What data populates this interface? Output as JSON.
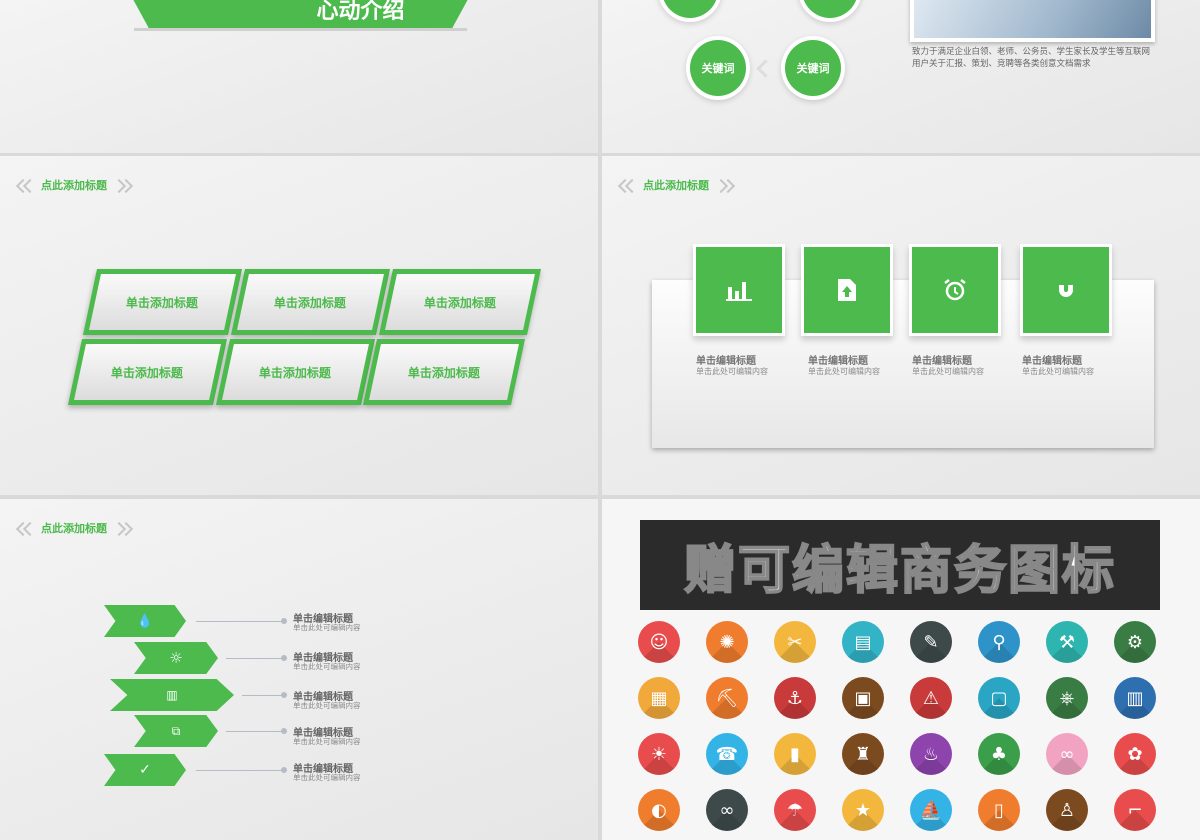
{
  "slide1": {
    "title_text": "心动介绍"
  },
  "slide2": {
    "keywords": [
      "关键词",
      "关键词"
    ],
    "description": "致力于满足企业白领、老师、公务员、学生家长及学生等互联网用户关于汇报、策划、竞聘等各类创意文档需求"
  },
  "slide3": {
    "header": "点此添加标题",
    "cards": [
      "单击添加标题",
      "单击添加标题",
      "单击添加标题",
      "单击添加标题",
      "单击添加标题",
      "单击添加标题"
    ]
  },
  "slide4": {
    "header": "点此添加标题",
    "items": [
      {
        "title": "单击编辑标题",
        "sub": "单击此处可编辑内容",
        "icon": "bar-chart-icon"
      },
      {
        "title": "单击编辑标题",
        "sub": "单击此处可编辑内容",
        "icon": "upload-icon"
      },
      {
        "title": "单击编辑标题",
        "sub": "单击此处可编辑内容",
        "icon": "alarm-clock-icon"
      },
      {
        "title": "单击编辑标题",
        "sub": "单击此处可编辑内容",
        "icon": "magnet-icon"
      }
    ]
  },
  "slide5": {
    "header": "点此添加标题",
    "items": [
      {
        "title": "单击编辑标题",
        "sub": "单击此处可编辑内容",
        "icon": "drops-icon"
      },
      {
        "title": "单击编辑标题",
        "sub": "单击此处可编辑内容",
        "icon": "sun-icon"
      },
      {
        "title": "单击编辑标题",
        "sub": "单击此处可编辑内容",
        "icon": "book-icon"
      },
      {
        "title": "单击编辑标题",
        "sub": "单击此处可编辑内容",
        "icon": "tags-icon"
      },
      {
        "title": "单击编辑标题",
        "sub": "单击此处可编辑内容",
        "icon": "check-icon"
      }
    ]
  },
  "slide6": {
    "banner": "赠可编辑商务图标",
    "icons": [
      {
        "name": "worker-icon",
        "color": "#e84c4c"
      },
      {
        "name": "saw-blade-icon",
        "color": "#f07d2e"
      },
      {
        "name": "tools-icon",
        "color": "#f3b73d"
      },
      {
        "name": "blueprint-icon",
        "color": "#33b3c6"
      },
      {
        "name": "pencil-ruler-icon",
        "color": "#3e4a4a"
      },
      {
        "name": "compass-icon",
        "color": "#2e93c9"
      },
      {
        "name": "hammer-icon",
        "color": "#2fb5b0"
      },
      {
        "name": "gears-icon",
        "color": "#3a7d44"
      },
      {
        "name": "brick-wall-icon",
        "color": "#f2a93b"
      },
      {
        "name": "excavator-icon",
        "color": "#f07d2e"
      },
      {
        "name": "crane-icon",
        "color": "#c93a3a"
      },
      {
        "name": "floor-plan-icon",
        "color": "#7b4a1f"
      },
      {
        "name": "warning-icon",
        "color": "#c93a3a"
      },
      {
        "name": "toolbox-icon",
        "color": "#2aa6c4"
      },
      {
        "name": "wheel-icon",
        "color": "#3a7d44"
      },
      {
        "name": "building-icon",
        "color": "#2e6fb0"
      },
      {
        "name": "sun-icon",
        "color": "#e84c4c"
      },
      {
        "name": "phone-drink-icon",
        "color": "#33b3e6"
      },
      {
        "name": "sunscreen-icon",
        "color": "#f3b73d"
      },
      {
        "name": "sandcastle-icon",
        "color": "#7b4a1f"
      },
      {
        "name": "popsicle-icon",
        "color": "#8e44ad"
      },
      {
        "name": "pineapple-icon",
        "color": "#3a9e4a"
      },
      {
        "name": "flip-flops-icon",
        "color": "#f2a3c2"
      },
      {
        "name": "bikini-icon",
        "color": "#e84c4c"
      },
      {
        "name": "beach-ball-icon",
        "color": "#f07d2e"
      },
      {
        "name": "sunglasses-icon",
        "color": "#3e4a4a"
      },
      {
        "name": "umbrella-icon",
        "color": "#e84c4c"
      },
      {
        "name": "starfish-icon",
        "color": "#f3b73d"
      },
      {
        "name": "sailboat-icon",
        "color": "#33b3e6"
      },
      {
        "name": "surfboard-icon",
        "color": "#f07d2e"
      },
      {
        "name": "sand-bucket-icon",
        "color": "#7b4a1f"
      },
      {
        "name": "beach-chair-icon",
        "color": "#e84c4c"
      }
    ],
    "glyphs": [
      "☺",
      "✺",
      "✂",
      "▤",
      "✎",
      "⚲",
      "⚒",
      "⚙",
      "▦",
      "⛏",
      "⚓",
      "▣",
      "⚠",
      "▢",
      "⎈",
      "▥",
      "☀",
      "☎",
      "▮",
      "♜",
      "♨",
      "♣",
      "∞",
      "✿",
      "◐",
      "∞",
      "☂",
      "★",
      "⛵",
      "▯",
      "♙",
      "⌐"
    ]
  },
  "colors": {
    "accent": "#4cba4c"
  }
}
